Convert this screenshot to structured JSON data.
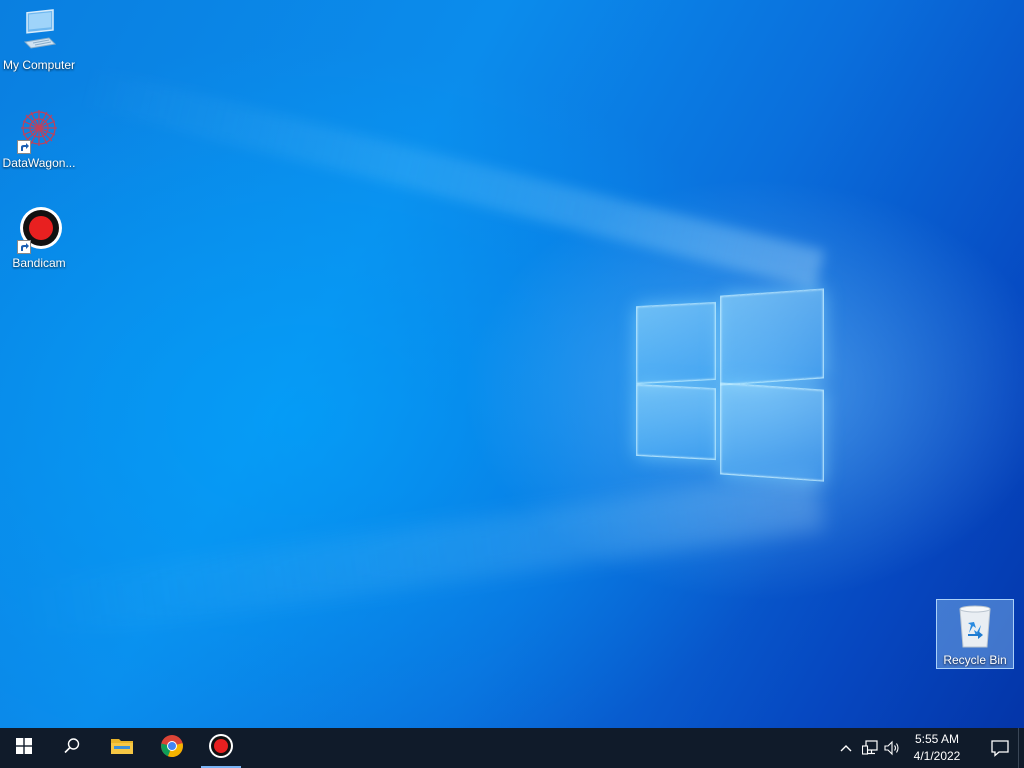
{
  "desktop": {
    "icons": [
      {
        "label": "My Computer",
        "icon": "computer-icon"
      },
      {
        "label": "DataWagon...",
        "icon": "datawagon-icon"
      },
      {
        "label": "Bandicam",
        "icon": "bandicam-record-icon"
      },
      {
        "label": "Recycle Bin",
        "icon": "recycle-bin-icon",
        "selected": true
      }
    ]
  },
  "taskbar": {
    "start": {
      "icon": "windows-logo-icon"
    },
    "search": {
      "icon": "search-icon"
    },
    "pinned": [
      {
        "name": "File Explorer",
        "icon": "folder-icon",
        "active": false
      },
      {
        "name": "Google Chrome",
        "icon": "chrome-icon",
        "active": false
      },
      {
        "name": "Bandicam",
        "icon": "bandicam-record-icon",
        "active": true
      }
    ],
    "tray": {
      "chevron_icon": "chevron-up-icon",
      "network_icon": "network-icon",
      "volume_icon": "volume-icon",
      "time": "5:55 AM",
      "date": "4/1/2022",
      "notification_icon": "notification-icon"
    }
  },
  "colors": {
    "taskbar_bg": "#101b2a",
    "active_indicator": "#7ab4f5",
    "bandicam_red": "#e82020"
  }
}
